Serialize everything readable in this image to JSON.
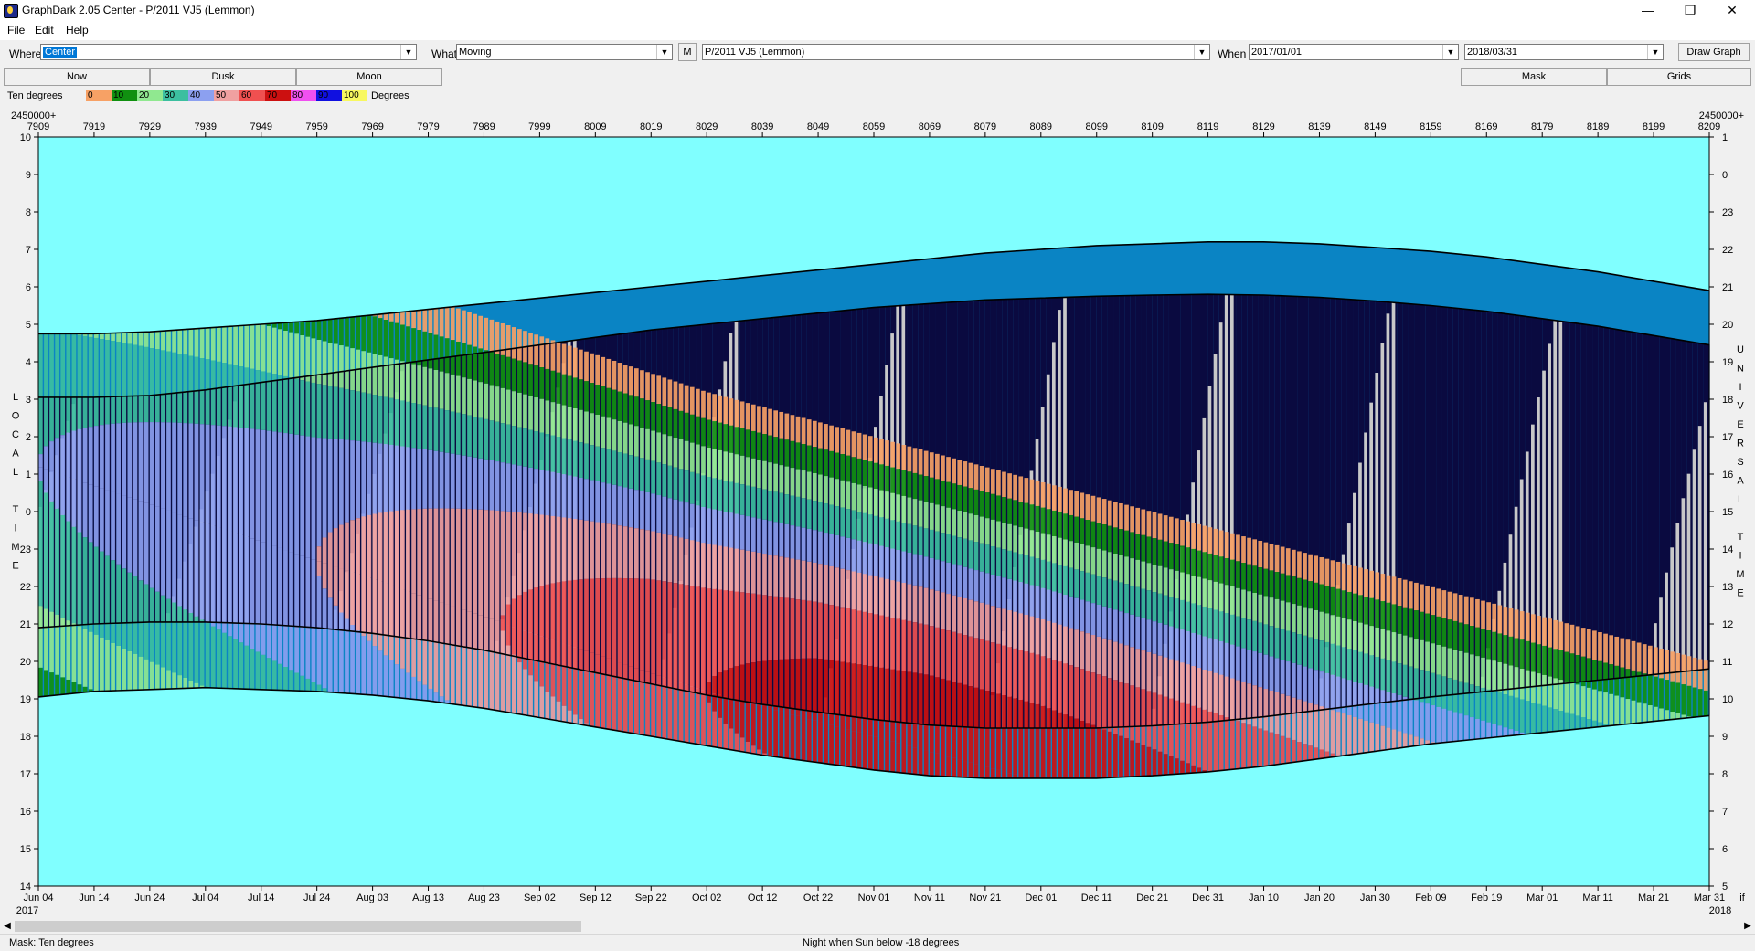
{
  "window": {
    "title": "GraphDark 2.05  Center  -  P/2011 VJ5 (Lemmon)",
    "minimize": "—",
    "restore": "❐",
    "close": "✕"
  },
  "menu": [
    "File",
    "Edit",
    "Help"
  ],
  "toolbar": {
    "where_label": "Where",
    "where_value": "Center",
    "what_label": "What",
    "what_value": "Moving",
    "m_button": "M",
    "object_value": "P/2011 VJ5 (Lemmon)",
    "when_label": "When",
    "when_from": "2017/01/01",
    "when_to": "2018/03/31",
    "draw_button": "Draw Graph"
  },
  "buttons": {
    "now": "Now",
    "dusk": "Dusk",
    "moon": "Moon",
    "mask": "Mask",
    "grids": "Grids"
  },
  "legend": {
    "label": "Ten degrees",
    "unit": "Degrees",
    "bins": [
      {
        "label": "0",
        "color": "#f7a165"
      },
      {
        "label": "10",
        "color": "#109010"
      },
      {
        "label": "20",
        "color": "#90e890"
      },
      {
        "label": "30",
        "color": "#3cbfa0"
      },
      {
        "label": "40",
        "color": "#8ca0f0"
      },
      {
        "label": "50",
        "color": "#f0a0a0"
      },
      {
        "label": "60",
        "color": "#f05050"
      },
      {
        "label": "70",
        "color": "#cc1010"
      },
      {
        "label": "80",
        "color": "#f050f0"
      },
      {
        "label": "90",
        "color": "#1010e0"
      },
      {
        "label": "100",
        "color": "#f8f860"
      }
    ]
  },
  "chart_data": {
    "type": "heatmap",
    "jd_prefix": "2450000+",
    "jd_ticks": [
      "7909",
      "7919",
      "7929",
      "7939",
      "7949",
      "7959",
      "7969",
      "7979",
      "7989",
      "7999",
      "8009",
      "8019",
      "8029",
      "8039",
      "8049",
      "8059",
      "8069",
      "8079",
      "8089",
      "8099",
      "8109",
      "8119",
      "8129",
      "8139",
      "8149",
      "8159",
      "8169",
      "8179",
      "8189",
      "8199",
      "8209"
    ],
    "date_ticks": [
      "Jun 04",
      "Jun 14",
      "Jun 24",
      "Jul 04",
      "Jul 14",
      "Jul 24",
      "Aug 03",
      "Aug 13",
      "Aug 23",
      "Sep 02",
      "Sep 12",
      "Sep 22",
      "Oct 02",
      "Oct 12",
      "Oct 22",
      "Nov 01",
      "Nov 11",
      "Nov 21",
      "Dec 01",
      "Dec 11",
      "Dec 21",
      "Dec 31",
      "Jan 10",
      "Jan 20",
      "Jan 30",
      "Feb 09",
      "Feb 19",
      "Mar 01",
      "Mar 11",
      "Mar 21",
      "Mar 31"
    ],
    "year_start": "2017",
    "year_end": "2018",
    "date_suffix": "if",
    "left_axis_ticks": [
      "10",
      "9",
      "8",
      "7",
      "6",
      "5",
      "4",
      "3",
      "2",
      "1",
      "0",
      "23",
      "22",
      "21",
      "20",
      "19",
      "18",
      "17",
      "16",
      "15",
      "14"
    ],
    "right_axis_ticks": [
      "1",
      "0",
      "23",
      "22",
      "21",
      "20",
      "19",
      "18",
      "17",
      "16",
      "15",
      "14",
      "13",
      "12",
      "11",
      "10",
      "9",
      "8",
      "7",
      "6",
      "5"
    ],
    "left_axis_label": [
      "L",
      "O",
      "C",
      "A",
      "L",
      "",
      "T",
      "I",
      "M",
      "E"
    ],
    "right_axis_label": [
      "U",
      "N",
      "I",
      "V",
      "E",
      "R",
      "S",
      "A",
      "L",
      "",
      "T",
      "I",
      "M",
      "E"
    ],
    "background_color": "#80ffff",
    "night_color": "#0a0a40",
    "twilight_color": "#0a84c4",
    "moon_color": "#c8c8c8",
    "sunset_hours": [
      19.05,
      19.2,
      19.25,
      19.3,
      19.25,
      19.2,
      19.1,
      18.95,
      18.75,
      18.5,
      18.25,
      18.0,
      17.75,
      17.5,
      17.3,
      17.1,
      16.95,
      16.88,
      16.88,
      16.88,
      16.95,
      17.05,
      17.2,
      17.4,
      17.6,
      17.8,
      17.95,
      18.1,
      18.25,
      18.4,
      18.55
    ],
    "sunrise_hours": [
      4.75,
      4.75,
      4.8,
      4.9,
      5.0,
      5.1,
      5.25,
      5.4,
      5.55,
      5.7,
      5.85,
      6.0,
      6.15,
      6.3,
      6.45,
      6.6,
      6.75,
      6.9,
      7.0,
      7.1,
      7.15,
      7.2,
      7.2,
      7.15,
      7.05,
      6.95,
      6.8,
      6.6,
      6.4,
      6.15,
      5.9
    ],
    "dusk_end_hours": [
      20.9,
      21.0,
      21.05,
      21.05,
      21.0,
      20.9,
      20.75,
      20.55,
      20.3,
      20.0,
      19.7,
      19.4,
      19.1,
      18.85,
      18.65,
      18.45,
      18.3,
      18.22,
      18.22,
      18.22,
      18.28,
      18.38,
      18.52,
      18.7,
      18.88,
      19.05,
      19.2,
      19.35,
      19.5,
      19.65,
      19.8
    ],
    "dawn_start_hours": [
      3.05,
      3.05,
      3.1,
      3.25,
      3.45,
      3.65,
      3.85,
      4.05,
      4.25,
      4.45,
      4.65,
      4.85,
      5.0,
      5.15,
      5.3,
      5.45,
      5.55,
      5.65,
      5.7,
      5.75,
      5.78,
      5.8,
      5.78,
      5.72,
      5.62,
      5.5,
      5.35,
      5.15,
      4.95,
      4.7,
      4.45
    ],
    "altitude_bands_deg": [
      0,
      10,
      20,
      30,
      40,
      50,
      60,
      70,
      80
    ],
    "transit_hours": [
      1.2,
      0.7,
      0.2,
      23.7,
      23.2,
      22.7,
      22.2,
      21.7,
      21.2,
      20.7,
      20.2,
      19.7,
      19.2,
      18.8,
      18.4,
      18.0,
      17.6,
      17.2,
      16.8,
      16.4,
      16.0,
      15.6,
      15.2,
      14.8,
      14.4,
      14.0,
      13.6,
      13.2,
      12.8,
      12.4,
      12.0
    ],
    "max_altitude_deg": [
      40,
      42,
      44,
      46,
      48,
      50,
      53,
      56,
      59,
      62,
      65,
      68,
      70,
      72,
      74,
      75,
      76,
      76,
      76,
      75,
      74,
      73,
      72,
      71,
      70,
      69,
      68,
      67,
      66,
      65,
      64
    ]
  },
  "status": {
    "mask": "Mask:  Ten degrees",
    "night": "Night when Sun below -18 degrees"
  }
}
